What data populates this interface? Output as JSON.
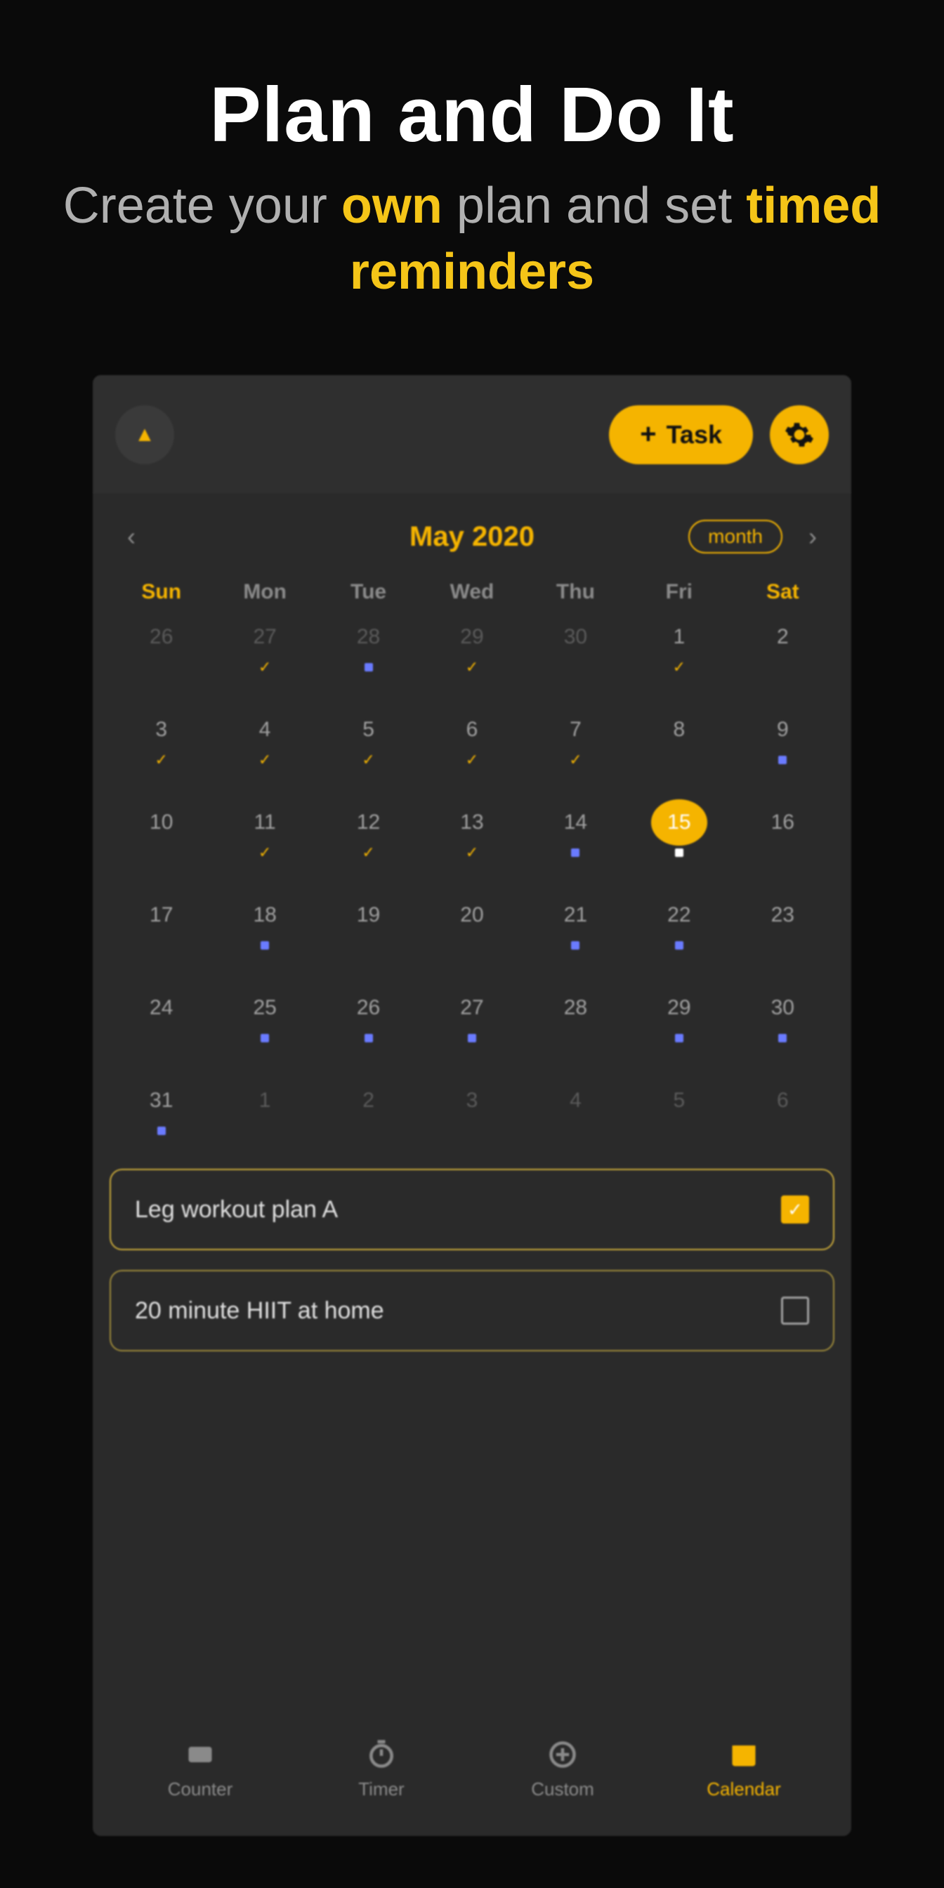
{
  "promo": {
    "title": "Plan and Do It",
    "sub_pre": "Create your ",
    "sub_em1": "own",
    "sub_mid": " plan and set ",
    "sub_em2": "timed reminders"
  },
  "topbar": {
    "task_label": "Task"
  },
  "calendar": {
    "month_label": "May 2020",
    "view_mode": "month",
    "dow": [
      "Sun",
      "Mon",
      "Tue",
      "Wed",
      "Thu",
      "Fri",
      "Sat"
    ],
    "days": [
      {
        "n": "26",
        "other": true,
        "marks": []
      },
      {
        "n": "27",
        "other": true,
        "marks": [
          "check"
        ]
      },
      {
        "n": "28",
        "other": true,
        "marks": [
          "dot"
        ]
      },
      {
        "n": "29",
        "other": true,
        "marks": [
          "check"
        ]
      },
      {
        "n": "30",
        "other": true,
        "marks": []
      },
      {
        "n": "1",
        "marks": [
          "check"
        ]
      },
      {
        "n": "2",
        "marks": []
      },
      {
        "n": "3",
        "marks": [
          "check"
        ]
      },
      {
        "n": "4",
        "marks": [
          "check"
        ]
      },
      {
        "n": "5",
        "marks": [
          "check"
        ]
      },
      {
        "n": "6",
        "marks": [
          "check"
        ]
      },
      {
        "n": "7",
        "marks": [
          "check"
        ]
      },
      {
        "n": "8",
        "marks": []
      },
      {
        "n": "9",
        "marks": [
          "dot"
        ]
      },
      {
        "n": "10",
        "marks": []
      },
      {
        "n": "11",
        "marks": [
          "check"
        ]
      },
      {
        "n": "12",
        "marks": [
          "check"
        ]
      },
      {
        "n": "13",
        "marks": [
          "check"
        ]
      },
      {
        "n": "14",
        "marks": [
          "dot"
        ]
      },
      {
        "n": "15",
        "marks": [
          "dot-sel"
        ],
        "selected": true
      },
      {
        "n": "16",
        "marks": []
      },
      {
        "n": "17",
        "marks": []
      },
      {
        "n": "18",
        "marks": [
          "dot"
        ]
      },
      {
        "n": "19",
        "marks": []
      },
      {
        "n": "20",
        "marks": []
      },
      {
        "n": "21",
        "marks": [
          "dot"
        ]
      },
      {
        "n": "22",
        "marks": [
          "dot"
        ]
      },
      {
        "n": "23",
        "marks": []
      },
      {
        "n": "24",
        "marks": []
      },
      {
        "n": "25",
        "marks": [
          "dot"
        ]
      },
      {
        "n": "26",
        "marks": [
          "dot"
        ]
      },
      {
        "n": "27",
        "marks": [
          "dot"
        ]
      },
      {
        "n": "28",
        "marks": []
      },
      {
        "n": "29",
        "marks": [
          "dot"
        ]
      },
      {
        "n": "30",
        "marks": [
          "dot"
        ]
      },
      {
        "n": "31",
        "marks": [
          "dot"
        ]
      },
      {
        "n": "1",
        "other": true,
        "marks": []
      },
      {
        "n": "2",
        "other": true,
        "marks": []
      },
      {
        "n": "3",
        "other": true,
        "marks": []
      },
      {
        "n": "4",
        "other": true,
        "marks": []
      },
      {
        "n": "5",
        "other": true,
        "marks": []
      },
      {
        "n": "6",
        "other": true,
        "marks": []
      }
    ]
  },
  "tasks": [
    {
      "title": "Leg workout plan A",
      "done": true
    },
    {
      "title": "20 minute HIIT at home",
      "done": false
    }
  ],
  "nav": {
    "items": [
      {
        "label": "Counter",
        "icon": "counter"
      },
      {
        "label": "Timer",
        "icon": "timer"
      },
      {
        "label": "Custom",
        "icon": "custom"
      },
      {
        "label": "Calendar",
        "icon": "calendar",
        "active": true
      }
    ]
  }
}
